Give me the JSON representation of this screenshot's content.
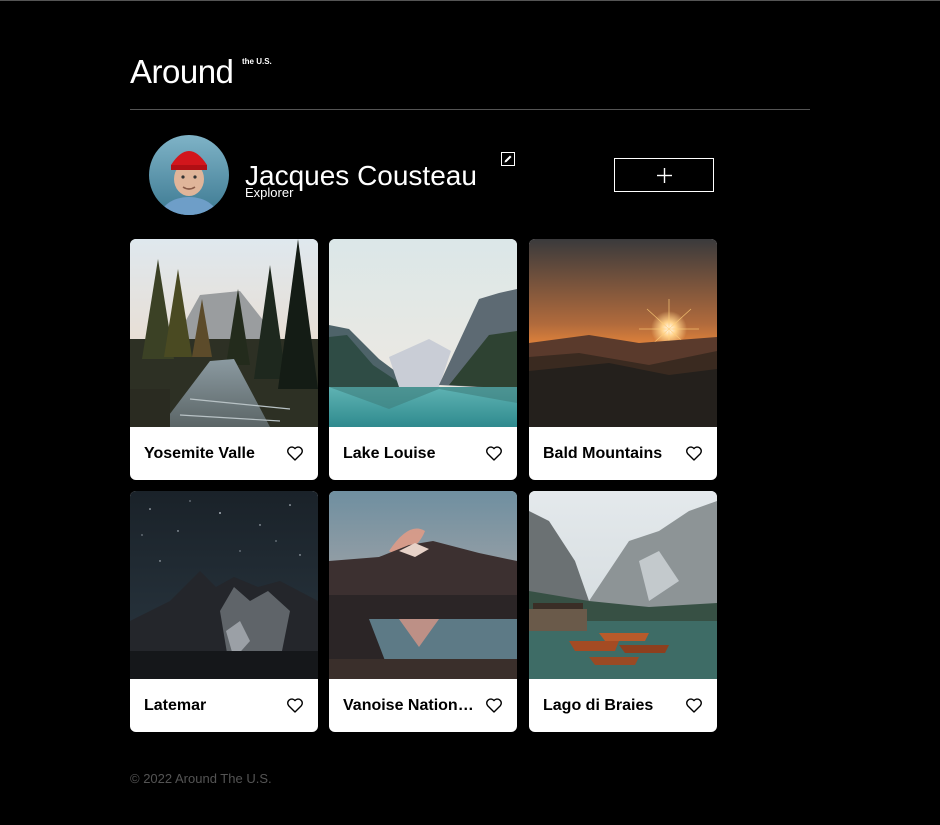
{
  "header": {
    "logo_main": "Around",
    "logo_sup": "the U.S."
  },
  "profile": {
    "name": "Jacques Cousteau",
    "job": "Explorer",
    "avatar_icon": "avatar-photo",
    "edit_icon": "pencil-edit-icon",
    "add_icon": "plus-icon"
  },
  "cards": [
    {
      "title": "Yosemite Valle",
      "image": "forest-river-photo"
    },
    {
      "title": "Lake Louise",
      "image": "mountain-lake-photo"
    },
    {
      "title": "Bald Mountains",
      "image": "sunset-mountains-photo"
    },
    {
      "title": "Latemar",
      "image": "night-mountain-photo"
    },
    {
      "title": "Vanoise Nation…",
      "image": "dusk-lake-photo"
    },
    {
      "title": "Lago di Braies",
      "image": "alpine-lake-boats-photo"
    }
  ],
  "footer": {
    "text": "© 2022 Around The U.S."
  },
  "colors": {
    "background": "#000000",
    "card": "#ffffff",
    "divider": "#545454",
    "footer_text": "#545454"
  }
}
